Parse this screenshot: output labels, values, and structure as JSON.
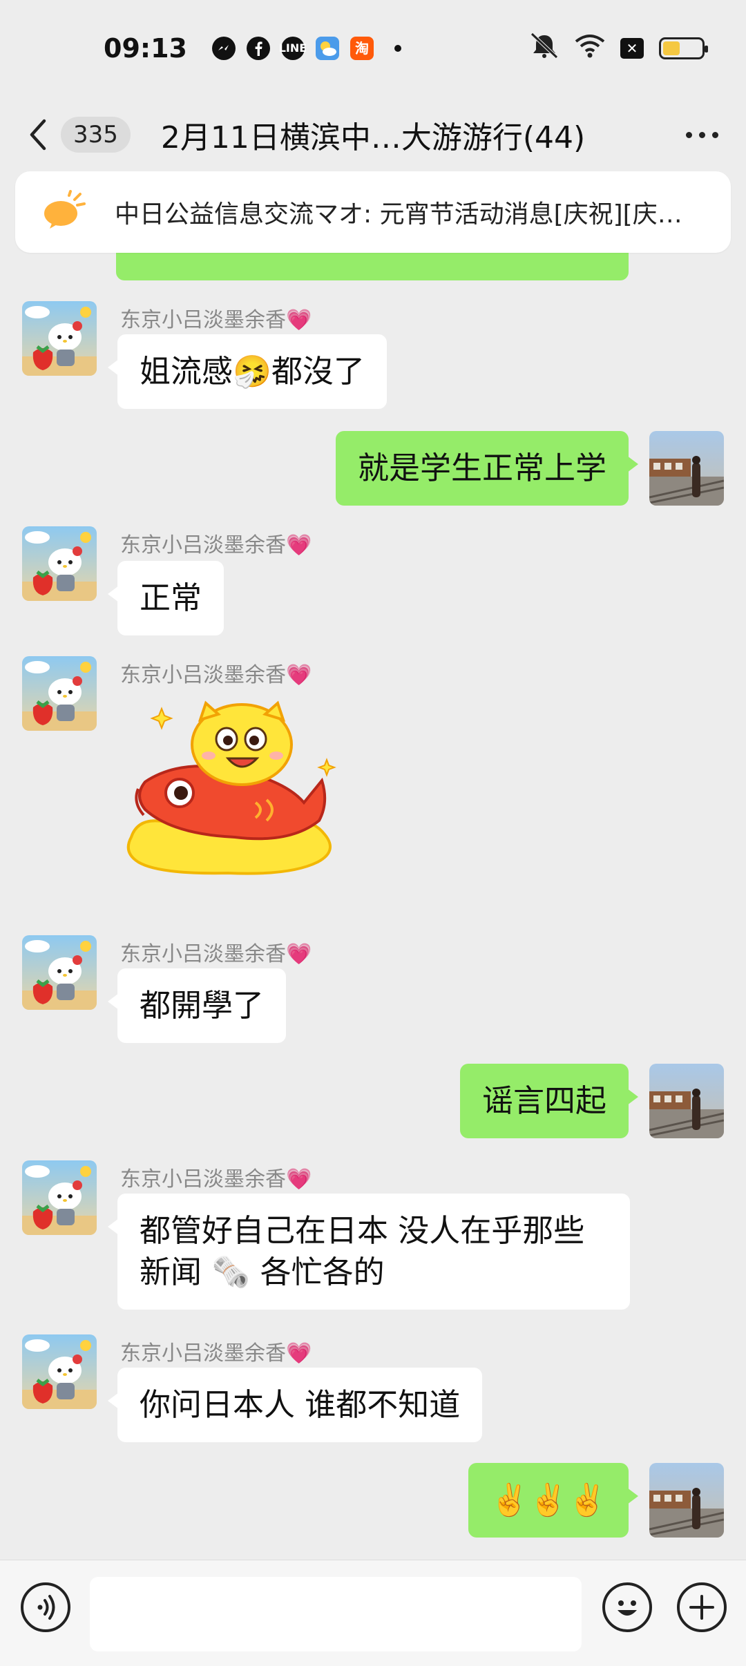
{
  "status_bar": {
    "time": "09:13",
    "apps": [
      "messenger-icon",
      "facebook-icon",
      "line-icon",
      "weather-icon",
      "taobao-icon"
    ],
    "line_label": "LINE",
    "taobao_label": "淘",
    "battery_level_percent": 45
  },
  "header": {
    "unread_count": "335",
    "title": "2月11日横滨中…大游游行(44)"
  },
  "pinned": {
    "text": "中日公益信息交流マオ: 元宵节活动消息[庆祝][庆…"
  },
  "messages": [
    {
      "direction": "in",
      "sender": "东京小吕淡墨余香💗",
      "type": "text",
      "text": "姐流感🤧都沒了"
    },
    {
      "direction": "out",
      "type": "text",
      "text": "就是学生正常上学"
    },
    {
      "direction": "in",
      "sender": "东京小吕淡墨余香💗",
      "type": "text",
      "text": "正常"
    },
    {
      "direction": "in",
      "sender": "东京小吕淡墨余香💗",
      "type": "sticker",
      "sticker": "cat-riding-fish-sticker"
    },
    {
      "direction": "in",
      "sender": "东京小吕淡墨余香💗",
      "type": "text",
      "text": "都開學了"
    },
    {
      "direction": "out",
      "type": "text",
      "text": "谣言四起"
    },
    {
      "direction": "in",
      "sender": "东京小吕淡墨余香💗",
      "type": "text",
      "text_line1": "都管好自己在日本 没人在乎那些",
      "text_line2": "新闻 🗞️ 各忙各的"
    },
    {
      "direction": "in",
      "sender": "东京小吕淡墨余香💗",
      "type": "text",
      "text": "你问日本人 谁都不知道"
    },
    {
      "direction": "out",
      "type": "text",
      "text": "✌️✌️✌️"
    }
  ],
  "colors": {
    "background": "#EDEDED",
    "outgoing_bubble": "#95EC69",
    "incoming_bubble": "#FFFFFF",
    "sender_name": "#888888"
  }
}
